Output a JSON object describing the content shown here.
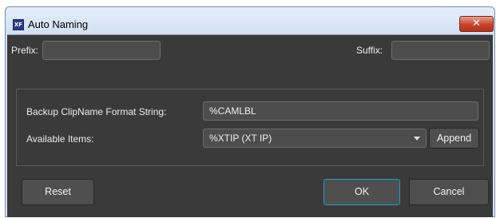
{
  "window": {
    "title": "Auto Naming",
    "app_icon_text": "XF",
    "close_glyph": "✕"
  },
  "prefix": {
    "label": "Prefix:",
    "value": ""
  },
  "suffix": {
    "label": "Suffix:",
    "value": ""
  },
  "backup_format": {
    "label": "Backup ClipName Format String:",
    "value": "%CAMLBL"
  },
  "available_items": {
    "label": "Available Items:",
    "selected": "%XTIP (XT IP)"
  },
  "buttons": {
    "append": "Append",
    "reset": "Reset",
    "ok": "OK",
    "cancel": "Cancel"
  },
  "colors": {
    "panel_bg": "#3a3a3a",
    "close_red": "#c7432a",
    "ok_focus": "#3b8fb0"
  }
}
